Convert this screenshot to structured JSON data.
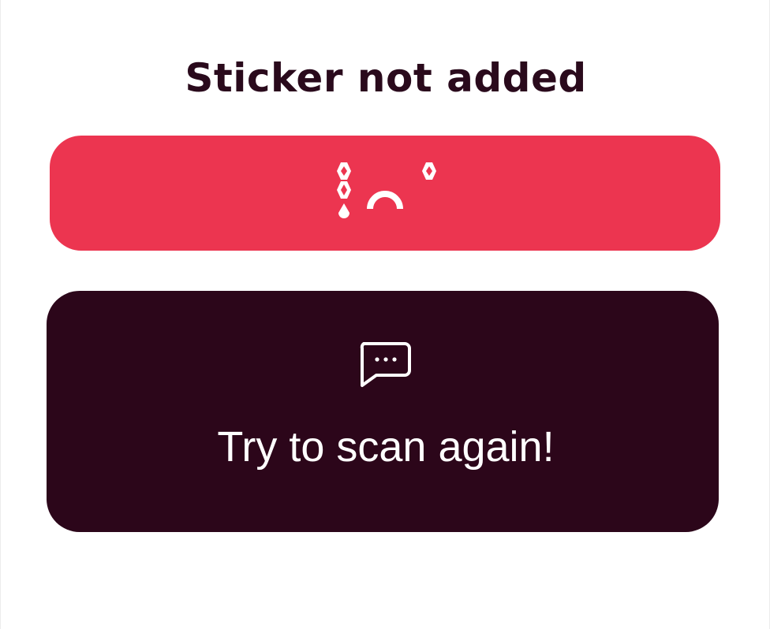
{
  "title": "Sticker not added",
  "status_banner": {
    "icon": "sad-face-icon",
    "color": "#ec3550"
  },
  "message_card": {
    "icon": "chat-bubble-icon",
    "text": "Try to scan again!",
    "color": "#2c061a"
  },
  "colors": {
    "text_dark": "#2a0a1c",
    "text_light": "#ffffff",
    "background": "#ffffff"
  }
}
